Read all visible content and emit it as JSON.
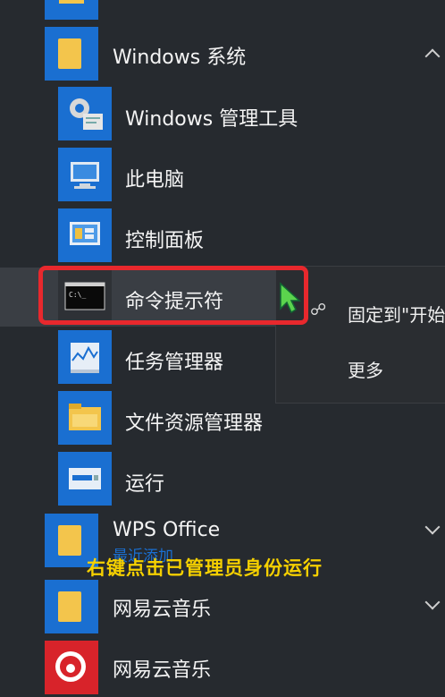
{
  "folder_windows_system": {
    "label": "Windows 系统"
  },
  "items": [
    {
      "label": "Windows 管理工具",
      "icon": "admin-tools-icon"
    },
    {
      "label": "此电脑",
      "icon": "computer-icon"
    },
    {
      "label": "控制面板",
      "icon": "control-panel-icon"
    },
    {
      "label": "命令提示符",
      "icon": "cmd-icon"
    },
    {
      "label": "任务管理器",
      "icon": "task-manager-icon"
    },
    {
      "label": "文件资源管理器",
      "icon": "file-explorer-icon"
    },
    {
      "label": "运行",
      "icon": "run-icon"
    }
  ],
  "folder_wps": {
    "label": "WPS Office",
    "sub": "最近添加"
  },
  "folder_netease": {
    "label": "网易云音乐"
  },
  "app_netease": {
    "label": "网易云音乐"
  },
  "context_menu": {
    "pin": "固定到\"开始\"",
    "more": "更多"
  },
  "caption": "右键点击已管理员身份运行",
  "colors": {
    "accent": "#1a6fd1",
    "highlight": "#e8282d",
    "caption": "#f5d000"
  }
}
